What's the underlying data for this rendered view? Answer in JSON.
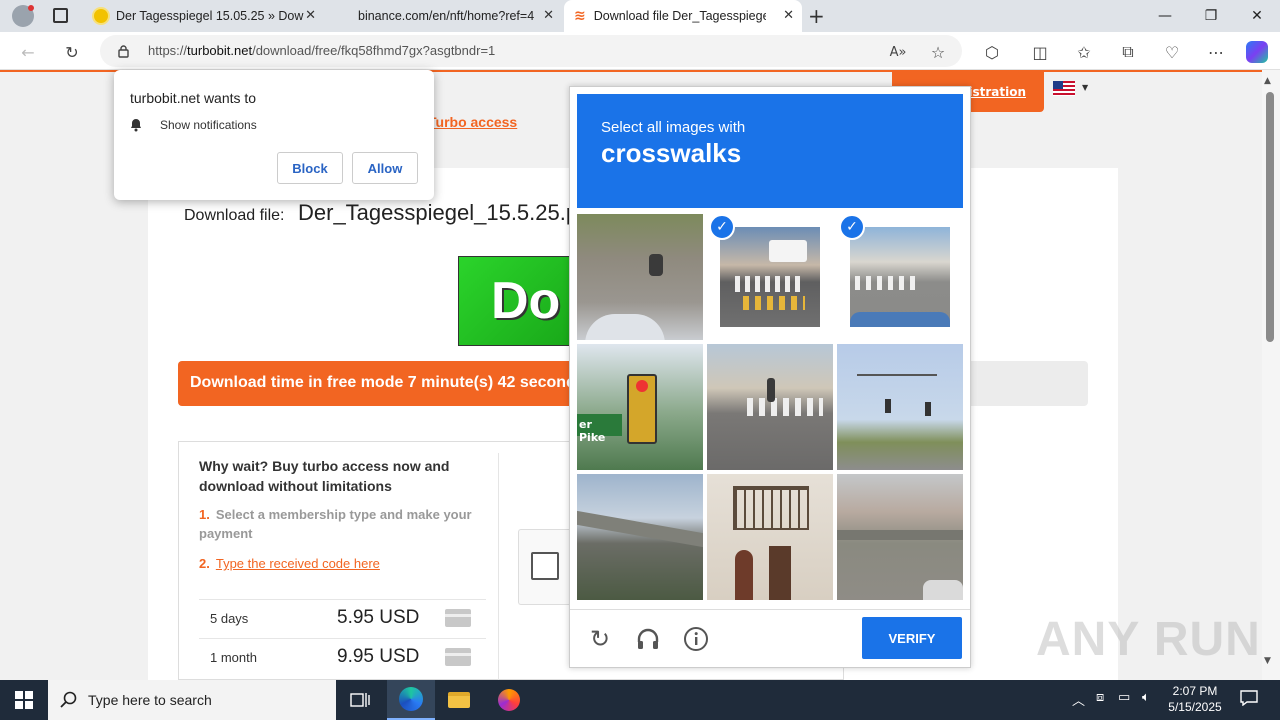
{
  "browser": {
    "tabs": [
      {
        "title": "Der Tagesspiegel 15.05.25 » Down",
        "favicon": "sun-icon"
      },
      {
        "title": "binance.com/en/nft/home?ref=4",
        "favicon": "none"
      },
      {
        "title": "Download file Der_Tagesspiegel_1",
        "favicon": "turbobit-icon"
      }
    ],
    "new_tab": "+",
    "url_host": "turbobit.net",
    "url_prefix": "https://",
    "url_path": "/download/free/fkq58fhmd7gx?asgtbndr=1"
  },
  "page": {
    "registration": "Registration",
    "turbo_access": "Turbo access",
    "download_file_label": "Download file:",
    "file_name": "Der_Tagesspiegel_15.5.25.pdf",
    "banner_text": "Do",
    "download_time": "Download time in free mode 7 minute(s) 42 seconds",
    "why_wait": "Why wait? Buy turbo access now and download without limitations",
    "step1_num": "1.",
    "step1": "Select a membership type and make your payment",
    "step2_num": "2.",
    "step2": "Type the received code here",
    "prices": [
      {
        "period": "5 days",
        "price": "5.95 USD"
      },
      {
        "period": "1 month",
        "price": "9.95 USD"
      }
    ]
  },
  "notification": {
    "title": "turbobit.net wants to",
    "permission": "Show notifications",
    "block": "Block",
    "allow": "Allow"
  },
  "captcha": {
    "instruction": "Select all images with",
    "target": "crosswalks",
    "verify": "VERIFY",
    "tiles": [
      {
        "subject": "motorbike-road",
        "selected": false
      },
      {
        "subject": "crosswalk-bus",
        "selected": true
      },
      {
        "subject": "crosswalk-street",
        "selected": true
      },
      {
        "subject": "traffic-light-sign",
        "selected": false
      },
      {
        "subject": "crosswalk-pedestrian",
        "selected": false
      },
      {
        "subject": "traffic-lights-intersection",
        "selected": false
      },
      {
        "subject": "overpass-train",
        "selected": false
      },
      {
        "subject": "balcony-building",
        "selected": false
      },
      {
        "subject": "overpass-road",
        "selected": false
      }
    ]
  },
  "watermark": "ANY RUN",
  "taskbar": {
    "search_placeholder": "Type here to search",
    "time": "2:07 PM",
    "date": "5/15/2025"
  },
  "colors": {
    "accent_orange": "#f26522",
    "captcha_blue": "#1a73e8"
  }
}
